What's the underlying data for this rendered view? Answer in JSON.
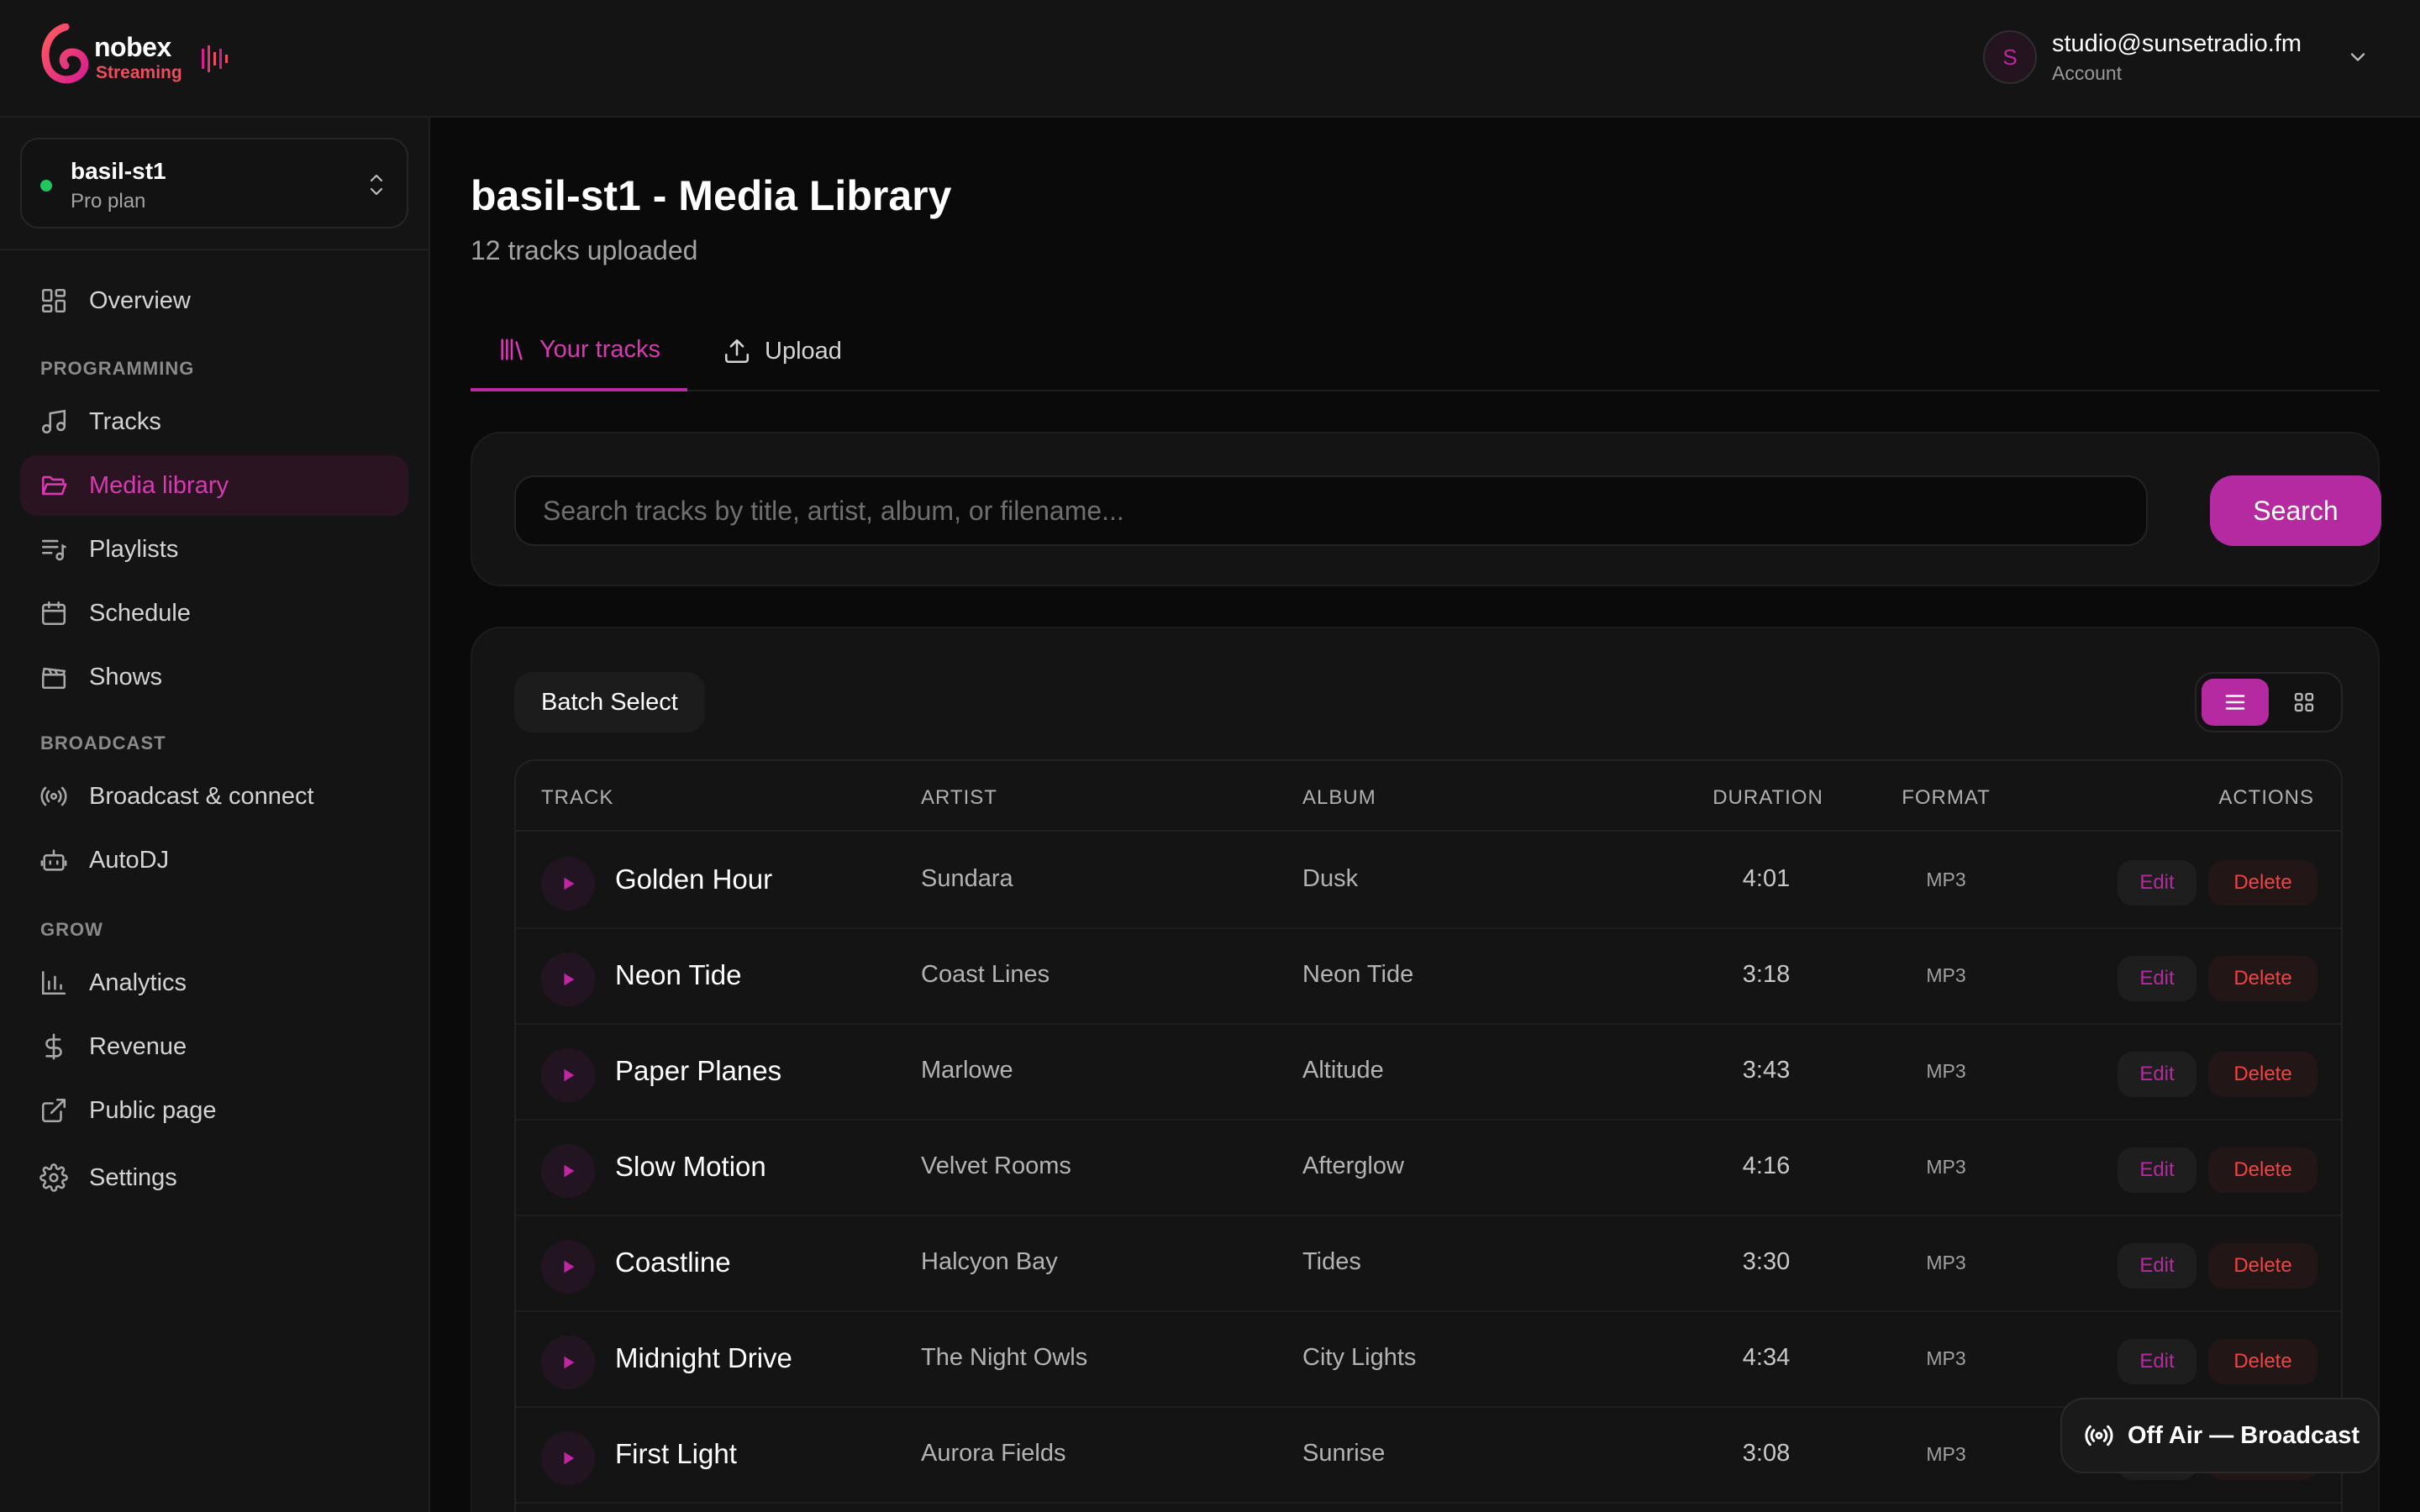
{
  "brand": {
    "name": "nobex",
    "sub": "Streaming",
    "accent": "#c026a0",
    "logo_red": "#e94f5f"
  },
  "account": {
    "initial": "S",
    "email": "studio@sunsetradio.fm",
    "label": "Account"
  },
  "station": {
    "name": "basil-st1",
    "plan": "Pro plan",
    "status_color": "#22c55e"
  },
  "sidebar": {
    "overview": "Overview",
    "programming_header": "PROGRAMMING",
    "tracks": "Tracks",
    "media_library": "Media library",
    "playlists": "Playlists",
    "schedule": "Schedule",
    "shows": "Shows",
    "broadcast_header": "BROADCAST",
    "broadcast_connect": "Broadcast & connect",
    "autodj": "AutoDJ",
    "grow_header": "GROW",
    "analytics": "Analytics",
    "revenue": "Revenue",
    "public_page": "Public page",
    "settings": "Settings"
  },
  "page": {
    "title": "basil-st1 - Media Library",
    "subtitle": "12 tracks uploaded"
  },
  "tabs": {
    "your_tracks": "Your tracks",
    "upload": "Upload"
  },
  "search": {
    "placeholder": "Search tracks by title, artist, album, or filename...",
    "button": "Search"
  },
  "toolbar": {
    "batch_select": "Batch Select"
  },
  "table": {
    "headers": {
      "track": "TRACK",
      "artist": "ARTIST",
      "album": "ALBUM",
      "duration": "DURATION",
      "format": "FORMAT",
      "actions": "ACTIONS"
    },
    "edit_label": "Edit",
    "delete_label": "Delete",
    "rows": [
      {
        "title": "Golden Hour",
        "artist": "Sundara",
        "album": "Dusk",
        "duration": "4:01",
        "format": "MP3"
      },
      {
        "title": "Neon Tide",
        "artist": "Coast Lines",
        "album": "Neon Tide",
        "duration": "3:18",
        "format": "MP3"
      },
      {
        "title": "Paper Planes",
        "artist": "Marlowe",
        "album": "Altitude",
        "duration": "3:43",
        "format": "MP3"
      },
      {
        "title": "Slow Motion",
        "artist": "Velvet Rooms",
        "album": "Afterglow",
        "duration": "4:16",
        "format": "MP3"
      },
      {
        "title": "Coastline",
        "artist": "Halcyon Bay",
        "album": "Tides",
        "duration": "3:30",
        "format": "MP3"
      },
      {
        "title": "Midnight Drive",
        "artist": "The Night Owls",
        "album": "City Lights",
        "duration": "4:34",
        "format": "MP3"
      },
      {
        "title": "First Light",
        "artist": "Aurora Fields",
        "album": "Sunrise",
        "duration": "3:08",
        "format": "MP3"
      }
    ]
  },
  "broadcast_status": {
    "label": "Off Air — Broadcast"
  },
  "icons": {
    "overview": "grid-icon",
    "tracks": "music-note-icon",
    "media": "folder-open-icon",
    "playlists": "playlist-icon",
    "schedule": "calendar-icon",
    "shows": "clapperboard-icon",
    "broadcast": "radio-waves-icon",
    "autodj": "robot-icon",
    "analytics": "bar-chart-icon",
    "revenue": "dollar-icon",
    "public_page": "external-link-icon",
    "settings": "gear-icon"
  }
}
